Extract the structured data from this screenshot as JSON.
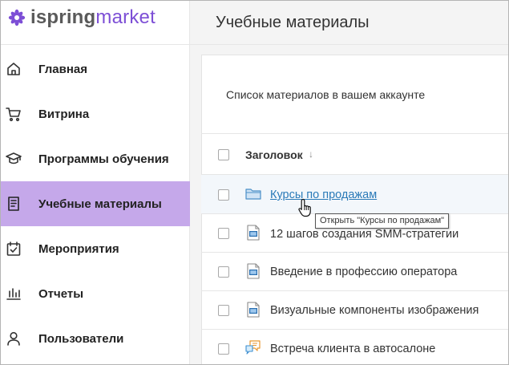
{
  "logo": {
    "part1": "ispring",
    "part2": "market"
  },
  "sidebar": {
    "items": [
      {
        "label": "Главная",
        "icon": "home-icon",
        "active": false
      },
      {
        "label": "Витрина",
        "icon": "cart-icon",
        "active": false
      },
      {
        "label": "Программы обучения",
        "icon": "graduation-cap-icon",
        "active": false
      },
      {
        "label": "Учебные материалы",
        "icon": "document-icon",
        "active": true
      },
      {
        "label": "Мероприятия",
        "icon": "calendar-check-icon",
        "active": false
      },
      {
        "label": "Отчеты",
        "icon": "bar-chart-icon",
        "active": false
      },
      {
        "label": "Пользователи",
        "icon": "user-icon",
        "active": false
      }
    ]
  },
  "header": {
    "title": "Учебные материалы"
  },
  "main": {
    "subtitle": "Список материалов в вашем аккаунте",
    "table": {
      "column_title": "Заголовок",
      "sort_indicator": "↓",
      "rows": [
        {
          "title": "Курсы по продажам",
          "icon": "folder-icon",
          "link": true
        },
        {
          "title": "12 шагов создания SMM-стратегии",
          "icon": "video-file-icon",
          "link": false
        },
        {
          "title": "Введение в профессию оператора",
          "icon": "video-file-icon",
          "link": false
        },
        {
          "title": "Визуальные компоненты изображения",
          "icon": "video-file-icon",
          "link": false
        },
        {
          "title": "Встреча клиента в автосалоне",
          "icon": "dialog-simulation-icon",
          "link": false
        }
      ]
    },
    "tooltip": "Открыть \"Курсы по продажам\""
  },
  "colors": {
    "brand": "#7d4fd6",
    "active_nav": "#c5a8ea",
    "link": "#2a7ab8"
  }
}
